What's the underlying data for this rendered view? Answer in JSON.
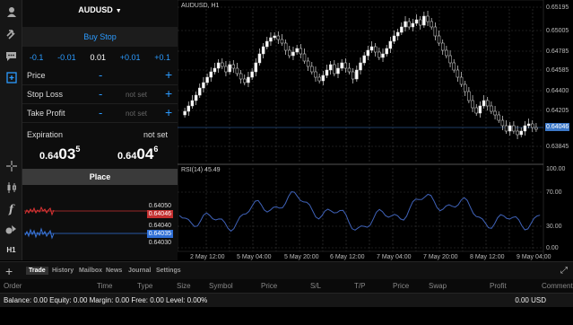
{
  "rail": {
    "icons": [
      "user-icon",
      "trade-arrows-icon",
      "chat-icon",
      "new-order-icon",
      "crosshair-icon",
      "candles-icon",
      "function-icon",
      "objects-icon",
      "timeframe-icon"
    ],
    "timeframe_label": "H1"
  },
  "order": {
    "symbol": "AUDUSD",
    "symbol_caret": "▼",
    "type": "Buy Stop",
    "steps": [
      "-0.1",
      "-0.01",
      "0.01",
      "+0.01",
      "+0.1"
    ],
    "price_label": "Price",
    "stoploss_label": "Stop Loss",
    "takeprofit_label": "Take Profit",
    "minus": "-",
    "plus": "+",
    "sl_value": "not set",
    "tp_value": "not set",
    "expiration_label": "Expiration",
    "expiration_value": "not set",
    "bid_prefix": "0.64",
    "bid_big": "03",
    "bid_sup": "5",
    "ask_prefix": "0.64",
    "ask_big": "04",
    "ask_sup": "6",
    "place_label": "Place",
    "tick_labels": [
      "0.64050",
      "0.64046",
      "0.64040",
      "0.64035",
      "0.64030"
    ]
  },
  "chart": {
    "title": "AUDUSD, H1",
    "rsi_title": "RSI(14) 45.49",
    "price_axis": [
      "0.65195",
      "0.65005",
      "0.64785",
      "0.64585",
      "0.64400",
      "0.64205",
      "0.64046",
      "0.63845"
    ],
    "current_price": "0.64046",
    "rsi_axis": [
      "100.00",
      "70.00",
      "30.00",
      "0.00"
    ],
    "time_axis": [
      "2 May 12:00",
      "5 May 04:00",
      "5 May 20:00",
      "6 May 12:00",
      "7 May 04:00",
      "7 May 20:00",
      "8 May 12:00",
      "9 May 04:00"
    ],
    "colors": {
      "up": "#ffffff",
      "down": "#000000",
      "rsi": "#3f62b8",
      "grid": "#3a3a3a",
      "current": "#3c78c8"
    }
  },
  "tabs": {
    "add": "+",
    "items": [
      "Trade",
      "History",
      "Mailbox",
      "News",
      "Journal",
      "Settings"
    ],
    "active": "Trade",
    "expand": "⤢"
  },
  "table": {
    "headers": [
      "Order",
      "Time",
      "Type",
      "Size",
      "Symbol",
      "Price",
      "S/L",
      "T/P",
      "Price",
      "Swap",
      "Profit",
      "Comment"
    ]
  },
  "balance": {
    "text": "Balance: 0.00 Equity: 0.00 Margin: 0.00 Free: 0.00 Level: 0.00%",
    "total": "0.00  USD"
  }
}
